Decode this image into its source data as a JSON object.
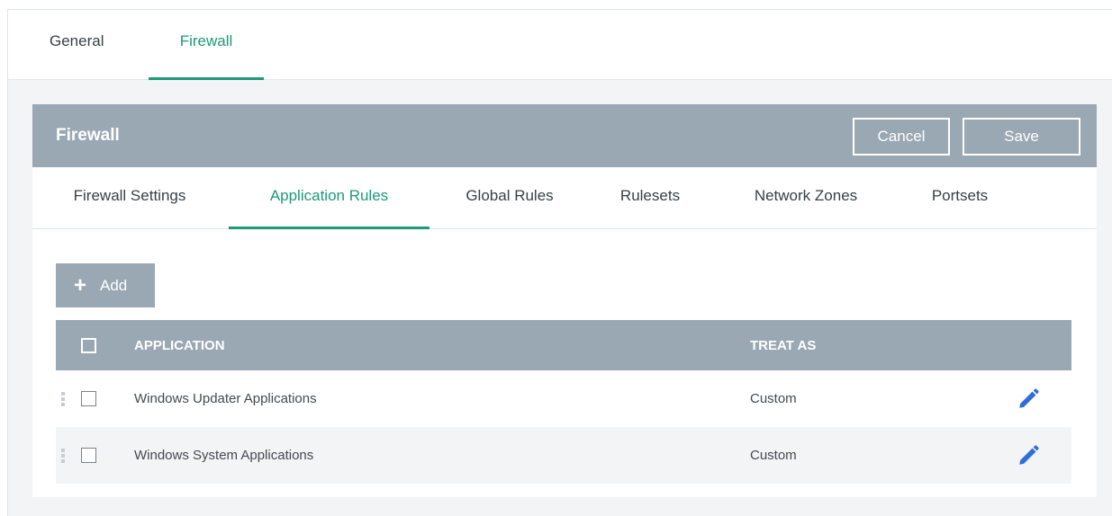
{
  "top_tabs": [
    {
      "label": "General"
    },
    {
      "label": "Firewall"
    }
  ],
  "panel": {
    "title": "Firewall",
    "cancel_label": "Cancel",
    "save_label": "Save"
  },
  "sub_tabs": [
    {
      "label": "Firewall Settings"
    },
    {
      "label": "Application Rules"
    },
    {
      "label": "Global Rules"
    },
    {
      "label": "Rulesets"
    },
    {
      "label": "Network Zones"
    },
    {
      "label": "Portsets"
    }
  ],
  "active_sub_tab": "Application Rules",
  "toolbar": {
    "add_label": "Add",
    "add_icon": "plus-icon"
  },
  "table": {
    "headers": {
      "application": "APPLICATION",
      "treat_as": "TREAT AS"
    },
    "rows": [
      {
        "application": "Windows Updater Applications",
        "treat_as": "Custom"
      },
      {
        "application": "Windows System Applications",
        "treat_as": "Custom"
      }
    ],
    "row_action_icon": "pencil-icon"
  },
  "colors": {
    "accent": "#1d9a76",
    "header_bg": "#9aa8b4",
    "edit_icon": "#2f6fd6"
  }
}
